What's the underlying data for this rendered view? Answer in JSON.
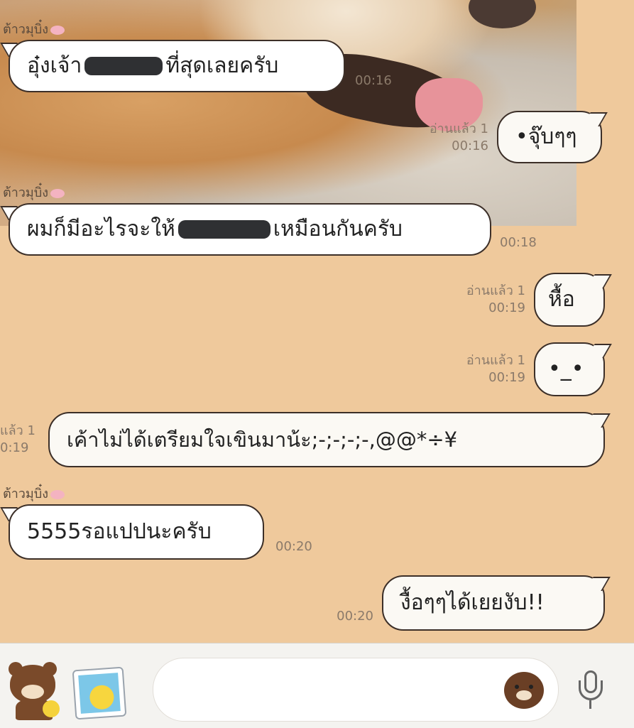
{
  "contact_name": "ต้าวมุบิ๋ง",
  "read_label": "อ่านแล้ว 1",
  "messages": [
    {
      "dir": "in",
      "text_before": "อุ๋งเจ้า",
      "text_after": "ที่สุดเลยครับ",
      "time": "00:16"
    },
    {
      "dir": "out",
      "text": "•จุ๊บๆๆ",
      "read": "อ่านแล้ว 1",
      "time": "00:16"
    },
    {
      "dir": "in",
      "text_before": "ผมก็มีอะไรจะให้",
      "text_after": "เหมือนกันครับ",
      "time": "00:18"
    },
    {
      "dir": "out",
      "text": "หื้อ",
      "read": "อ่านแล้ว 1",
      "time": "00:19"
    },
    {
      "dir": "out",
      "text": "•_•",
      "read": "อ่านแล้ว 1",
      "time": "00:19"
    },
    {
      "dir": "out",
      "text": "เค้าไม่ได้เตรียมใจเขินมาน้ะ;-;-;-;-,@@*÷¥",
      "read": "แล้ว 1",
      "time": "0:19"
    },
    {
      "dir": "in",
      "text": "5555รอแปปนะครับ",
      "time": "00:20"
    },
    {
      "dir": "out",
      "text": "งื้อๆๆได้เยยงับ!!",
      "time": "00:20"
    }
  ],
  "input": {
    "placeholder": ""
  },
  "icons": [
    "bear-sticker-icon",
    "photo-gallery-icon",
    "emoji-bear-icon",
    "microphone-icon"
  ]
}
